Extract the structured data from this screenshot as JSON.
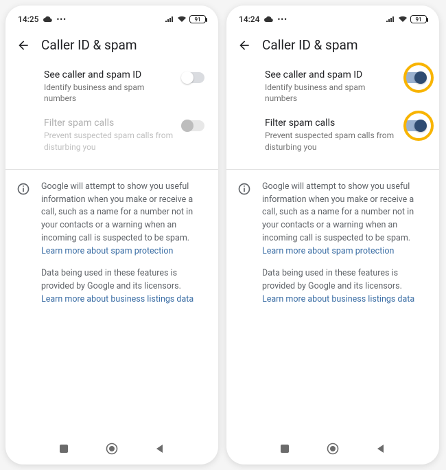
{
  "left": {
    "status": {
      "time": "14:25",
      "battery": "91"
    },
    "title": "Caller ID & spam",
    "setting1": {
      "title": "See caller and spam ID",
      "sub": "Identify business and spam numbers"
    },
    "setting2": {
      "title": "Filter spam calls",
      "sub": "Prevent suspected spam calls from disturbing you"
    },
    "info1_a": "Google will attempt to show you useful information when you make or receive a call, such as a name for a number not in your contacts or a warning when an incoming call is suspected to be spam. ",
    "info1_link": "Learn more about spam protection",
    "info2_a": "Data being used in these features is provided by Google and its licensors. ",
    "info2_link": "Learn more about business listings data"
  },
  "right": {
    "status": {
      "time": "14:24",
      "battery": "91"
    },
    "title": "Caller ID & spam",
    "setting1": {
      "title": "See caller and spam ID",
      "sub": "Identify business and spam numbers"
    },
    "setting2": {
      "title": "Filter spam calls",
      "sub": "Prevent suspected spam calls from disturbing you"
    },
    "info1_a": "Google will attempt to show you useful information when you make or receive a call, such as a name for a number not in your contacts or a warning when an incoming call is suspected to be spam. ",
    "info1_link": "Learn more about spam protection",
    "info2_a": "Data being used in these features is provided by Google and its licensors. ",
    "info2_link": "Learn more about business listings data"
  }
}
